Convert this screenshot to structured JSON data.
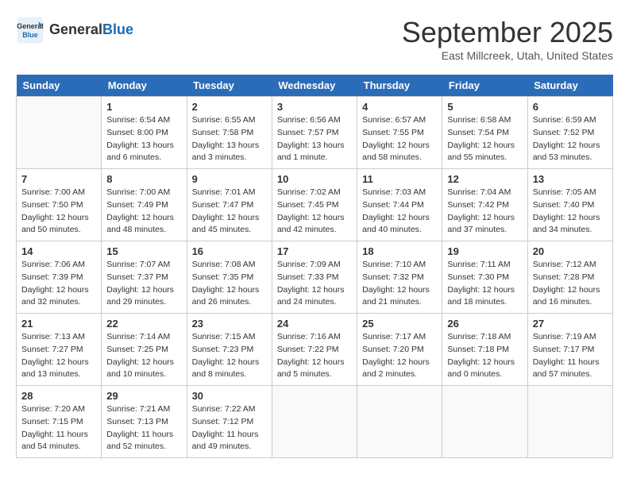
{
  "header": {
    "logo_line1": "General",
    "logo_line2": "Blue",
    "title": "September 2025",
    "subtitle": "East Millcreek, Utah, United States"
  },
  "days_of_week": [
    "Sunday",
    "Monday",
    "Tuesday",
    "Wednesday",
    "Thursday",
    "Friday",
    "Saturday"
  ],
  "weeks": [
    [
      {
        "day": "",
        "info": ""
      },
      {
        "day": "1",
        "info": "Sunrise: 6:54 AM\nSunset: 8:00 PM\nDaylight: 13 hours\nand 6 minutes."
      },
      {
        "day": "2",
        "info": "Sunrise: 6:55 AM\nSunset: 7:58 PM\nDaylight: 13 hours\nand 3 minutes."
      },
      {
        "day": "3",
        "info": "Sunrise: 6:56 AM\nSunset: 7:57 PM\nDaylight: 13 hours\nand 1 minute."
      },
      {
        "day": "4",
        "info": "Sunrise: 6:57 AM\nSunset: 7:55 PM\nDaylight: 12 hours\nand 58 minutes."
      },
      {
        "day": "5",
        "info": "Sunrise: 6:58 AM\nSunset: 7:54 PM\nDaylight: 12 hours\nand 55 minutes."
      },
      {
        "day": "6",
        "info": "Sunrise: 6:59 AM\nSunset: 7:52 PM\nDaylight: 12 hours\nand 53 minutes."
      }
    ],
    [
      {
        "day": "7",
        "info": "Sunrise: 7:00 AM\nSunset: 7:50 PM\nDaylight: 12 hours\nand 50 minutes."
      },
      {
        "day": "8",
        "info": "Sunrise: 7:00 AM\nSunset: 7:49 PM\nDaylight: 12 hours\nand 48 minutes."
      },
      {
        "day": "9",
        "info": "Sunrise: 7:01 AM\nSunset: 7:47 PM\nDaylight: 12 hours\nand 45 minutes."
      },
      {
        "day": "10",
        "info": "Sunrise: 7:02 AM\nSunset: 7:45 PM\nDaylight: 12 hours\nand 42 minutes."
      },
      {
        "day": "11",
        "info": "Sunrise: 7:03 AM\nSunset: 7:44 PM\nDaylight: 12 hours\nand 40 minutes."
      },
      {
        "day": "12",
        "info": "Sunrise: 7:04 AM\nSunset: 7:42 PM\nDaylight: 12 hours\nand 37 minutes."
      },
      {
        "day": "13",
        "info": "Sunrise: 7:05 AM\nSunset: 7:40 PM\nDaylight: 12 hours\nand 34 minutes."
      }
    ],
    [
      {
        "day": "14",
        "info": "Sunrise: 7:06 AM\nSunset: 7:39 PM\nDaylight: 12 hours\nand 32 minutes."
      },
      {
        "day": "15",
        "info": "Sunrise: 7:07 AM\nSunset: 7:37 PM\nDaylight: 12 hours\nand 29 minutes."
      },
      {
        "day": "16",
        "info": "Sunrise: 7:08 AM\nSunset: 7:35 PM\nDaylight: 12 hours\nand 26 minutes."
      },
      {
        "day": "17",
        "info": "Sunrise: 7:09 AM\nSunset: 7:33 PM\nDaylight: 12 hours\nand 24 minutes."
      },
      {
        "day": "18",
        "info": "Sunrise: 7:10 AM\nSunset: 7:32 PM\nDaylight: 12 hours\nand 21 minutes."
      },
      {
        "day": "19",
        "info": "Sunrise: 7:11 AM\nSunset: 7:30 PM\nDaylight: 12 hours\nand 18 minutes."
      },
      {
        "day": "20",
        "info": "Sunrise: 7:12 AM\nSunset: 7:28 PM\nDaylight: 12 hours\nand 16 minutes."
      }
    ],
    [
      {
        "day": "21",
        "info": "Sunrise: 7:13 AM\nSunset: 7:27 PM\nDaylight: 12 hours\nand 13 minutes."
      },
      {
        "day": "22",
        "info": "Sunrise: 7:14 AM\nSunset: 7:25 PM\nDaylight: 12 hours\nand 10 minutes."
      },
      {
        "day": "23",
        "info": "Sunrise: 7:15 AM\nSunset: 7:23 PM\nDaylight: 12 hours\nand 8 minutes."
      },
      {
        "day": "24",
        "info": "Sunrise: 7:16 AM\nSunset: 7:22 PM\nDaylight: 12 hours\nand 5 minutes."
      },
      {
        "day": "25",
        "info": "Sunrise: 7:17 AM\nSunset: 7:20 PM\nDaylight: 12 hours\nand 2 minutes."
      },
      {
        "day": "26",
        "info": "Sunrise: 7:18 AM\nSunset: 7:18 PM\nDaylight: 12 hours\nand 0 minutes."
      },
      {
        "day": "27",
        "info": "Sunrise: 7:19 AM\nSunset: 7:17 PM\nDaylight: 11 hours\nand 57 minutes."
      }
    ],
    [
      {
        "day": "28",
        "info": "Sunrise: 7:20 AM\nSunset: 7:15 PM\nDaylight: 11 hours\nand 54 minutes."
      },
      {
        "day": "29",
        "info": "Sunrise: 7:21 AM\nSunset: 7:13 PM\nDaylight: 11 hours\nand 52 minutes."
      },
      {
        "day": "30",
        "info": "Sunrise: 7:22 AM\nSunset: 7:12 PM\nDaylight: 11 hours\nand 49 minutes."
      },
      {
        "day": "",
        "info": ""
      },
      {
        "day": "",
        "info": ""
      },
      {
        "day": "",
        "info": ""
      },
      {
        "day": "",
        "info": ""
      }
    ]
  ]
}
